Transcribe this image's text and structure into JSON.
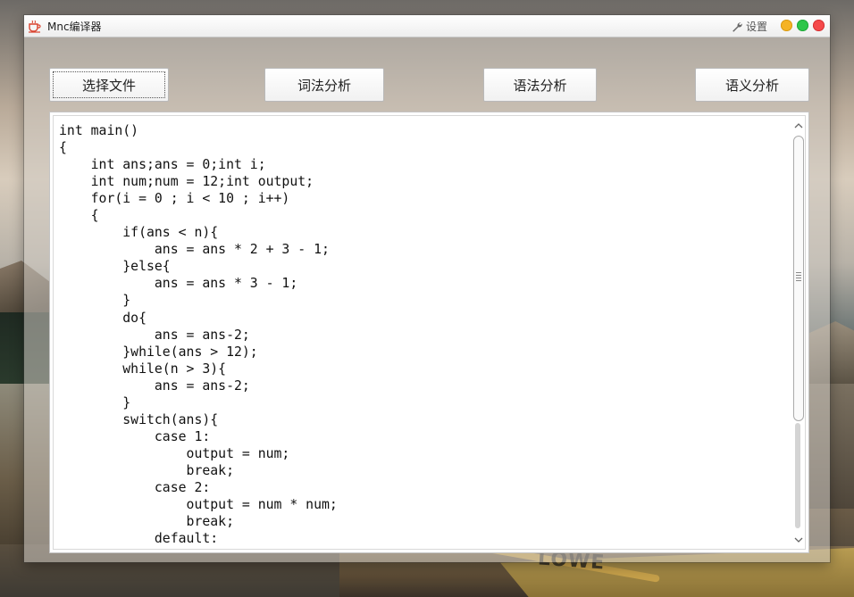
{
  "window": {
    "title": "Mnc编译器",
    "settings_label": "设置"
  },
  "toolbar": {
    "select_file": "选择文件",
    "lexical": "词法分析",
    "syntax": "语法分析",
    "semantic": "语义分析"
  },
  "editor": {
    "code_lines": [
      "int main()",
      "{",
      "    int ans;ans = 0;int i;",
      "    int num;num = 12;int output;",
      "    for(i = 0 ; i < 10 ; i++)",
      "    {",
      "        if(ans < n){",
      "            ans = ans * 2 + 3 - 1;",
      "        }else{",
      "            ans = ans * 3 - 1;",
      "        }",
      "        do{",
      "            ans = ans-2;",
      "        }while(ans > 12);",
      "        while(n > 3){",
      "            ans = ans-2;",
      "        }",
      "        switch(ans){",
      "            case 1:",
      "                output = num;",
      "                break;",
      "            case 2:",
      "                output = num * num;",
      "                break;",
      "            default:"
    ],
    "scroll_up_icon": "chevron-up-icon",
    "scroll_down_icon": "chevron-down-icon"
  },
  "desktop": {
    "boat_text": "LOWE"
  },
  "colors": {
    "minimize": "#f5b324",
    "maximize": "#2ec64a",
    "close": "#f5494a"
  }
}
